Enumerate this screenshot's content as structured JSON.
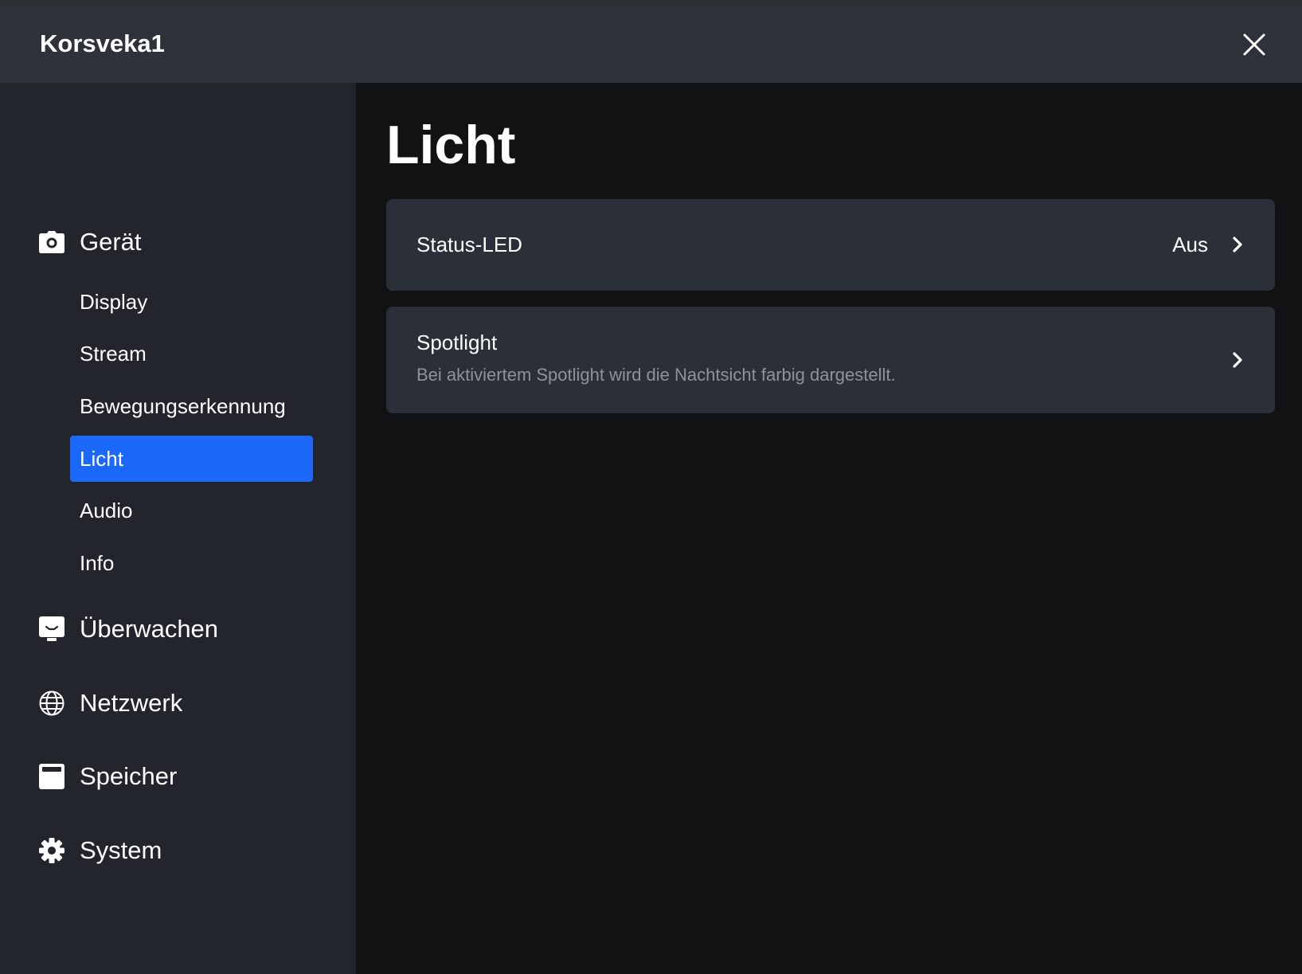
{
  "window": {
    "title": "Korsveka1"
  },
  "sidebar": {
    "sections": [
      {
        "label": "Gerät",
        "icon": "camera-icon",
        "items": [
          {
            "label": "Display"
          },
          {
            "label": "Stream"
          },
          {
            "label": "Bewegungserkennung"
          },
          {
            "label": "Licht",
            "active": true
          },
          {
            "label": "Audio"
          },
          {
            "label": "Info"
          }
        ]
      },
      {
        "label": "Überwachen",
        "icon": "monitor-icon"
      },
      {
        "label": "Netzwerk",
        "icon": "globe-icon"
      },
      {
        "label": "Speicher",
        "icon": "storage-icon"
      },
      {
        "label": "System",
        "icon": "gear-icon"
      }
    ]
  },
  "main": {
    "title": "Licht",
    "cards": [
      {
        "title": "Status-LED",
        "value": "Aus"
      },
      {
        "title": "Spotlight",
        "description": "Bei aktiviertem Spotlight wird die Nachtsicht farbig dargestellt."
      }
    ]
  },
  "colors": {
    "accent": "#1c68fb",
    "sidebar_bg": "#22252b",
    "content_bg": "#111213",
    "card_bg": "#2b2f37",
    "titlebar_bg": "#2d323b",
    "muted_text": "#8d929b"
  }
}
